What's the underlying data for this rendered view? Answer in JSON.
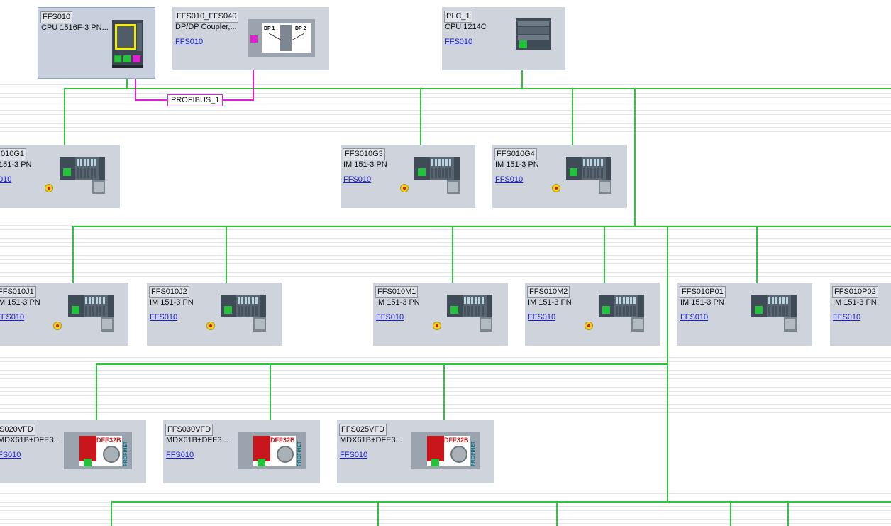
{
  "subnets": {
    "profibus_label": "PROFIBUS_1"
  },
  "colors": {
    "profinet": "#2fc63f",
    "profibus": "#e020d0",
    "device_bg": "#cfd3dc",
    "link": "#1a1fd0"
  },
  "devices": {
    "cpu_main": {
      "name": "FFS010",
      "type": "CPU 1516F-3 PN...",
      "icon": "cpu-1516f-icon"
    },
    "dp_coupler": {
      "name": "FFS010_FFS040",
      "type": "DP/DP Coupler,...",
      "link": "FFS010",
      "icon": "dp-coupler-icon",
      "dp1": "DP 1",
      "dp2": "DP 2"
    },
    "plc_1": {
      "name": "PLC_1",
      "type": "CPU 1214C",
      "link": "FFS010",
      "icon": "cpu-1214c-icon"
    },
    "g1": {
      "name": "010G1",
      "type": "151-3 PN",
      "link": "010"
    },
    "g3": {
      "name": "FFS010G3",
      "type": "IM 151-3 PN",
      "link": "FFS010"
    },
    "g4": {
      "name": "FFS010G4",
      "type": "IM 151-3 PN",
      "link": "FFS010"
    },
    "j1": {
      "name": "FFS010J1",
      "type": "IM 151-3 PN",
      "link": "FFS010"
    },
    "j2": {
      "name": "FFS010J2",
      "type": "IM 151-3 PN",
      "link": "FFS010"
    },
    "m1": {
      "name": "FFS010M1",
      "type": "IM 151-3 PN",
      "link": "FFS010"
    },
    "m2": {
      "name": "FFS010M2",
      "type": "IM 151-3 PN",
      "link": "FFS010"
    },
    "p01": {
      "name": "FFS010P01",
      "type": "IM 151-3 PN",
      "link": "FFS010"
    },
    "p02": {
      "name": "FFS010P02",
      "type": "IM 151-3 PN",
      "link": "FFS010"
    },
    "vfd020": {
      "name": "S020VFD",
      "type": "MDX61B+DFE3...",
      "link": "FS010"
    },
    "vfd030": {
      "name": "FFS030VFD",
      "type": "MDX61B+DFE3...",
      "link": "FFS010"
    },
    "vfd025": {
      "name": "FFS025VFD",
      "type": "MDX61B+DFE3...",
      "link": "FFS010"
    }
  },
  "vfd_icon": {
    "label": "DFE32B",
    "side_text": "PROFINET"
  }
}
